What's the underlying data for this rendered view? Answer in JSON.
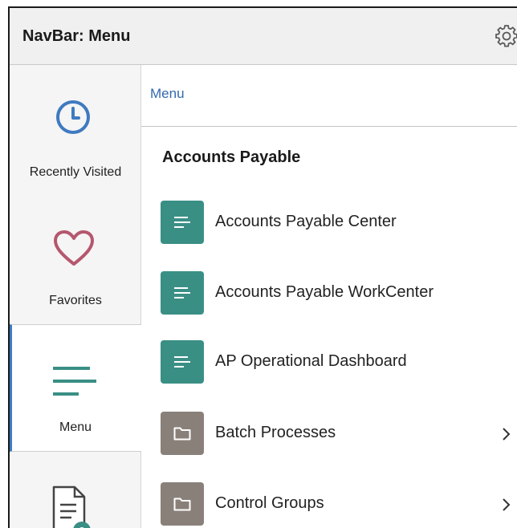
{
  "header": {
    "title": "NavBar: Menu",
    "settings_icon": "gear-icon"
  },
  "sidebar": {
    "items": [
      {
        "label": "Recently Visited",
        "icon": "clock-icon",
        "active": false
      },
      {
        "label": "Favorites",
        "icon": "heart-icon",
        "active": false
      },
      {
        "label": "Menu",
        "icon": "menu-lines-icon",
        "active": true
      },
      {
        "label": "",
        "icon": "document-gear-icon",
        "active": false
      }
    ]
  },
  "content": {
    "breadcrumb": "Menu",
    "section_title": "Accounts Payable",
    "items": [
      {
        "label": "Accounts Payable Center",
        "type": "page",
        "icon": "page-lines-icon"
      },
      {
        "label": "Accounts Payable WorkCenter",
        "type": "page",
        "icon": "page-lines-icon"
      },
      {
        "label": "AP Operational Dashboard",
        "type": "page",
        "icon": "page-lines-icon"
      },
      {
        "label": "Batch Processes",
        "type": "folder",
        "icon": "folder-icon"
      },
      {
        "label": "Control Groups",
        "type": "folder",
        "icon": "folder-icon"
      }
    ]
  },
  "colors": {
    "accent_blue": "#3e7ac0",
    "link_blue": "#3368b0",
    "teal_tile": "#3a8f85",
    "folder_tile": "#8a807a",
    "heart": "#b5576e",
    "menu_icon": "#3a8f85"
  }
}
